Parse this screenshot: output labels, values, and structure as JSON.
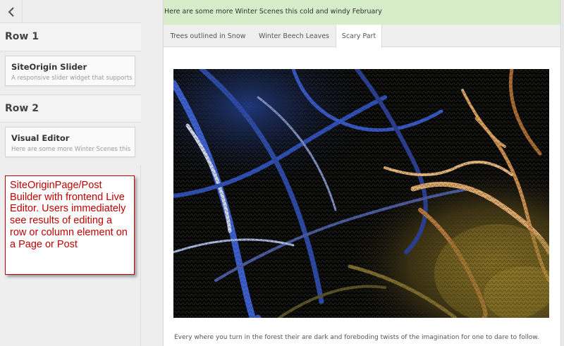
{
  "sidebar": {
    "back_icon": "chevron-left-icon",
    "rows": [
      {
        "label": "Row 1",
        "widget": {
          "title": "SiteOrigin Slider",
          "description": "A responsive slider widget that supports"
        }
      },
      {
        "label": "Row 2",
        "widget": {
          "title": "Visual Editor",
          "description": "Here are some more Winter Scenes this"
        }
      }
    ],
    "annotation": "SiteOriginPage/Post Builder with frontend Live Editor. Users immediately see results of editing a row or column element on a Page or Post"
  },
  "preview": {
    "notice": "Here are some more Winter Scenes this cold and windy February",
    "tabs": [
      {
        "label": "Trees outlined in Snow",
        "active": false
      },
      {
        "label": "Winter Beech Leaves",
        "active": false
      },
      {
        "label": "Scary Part",
        "active": true
      }
    ],
    "caption": "Every where you turn in the forest their are dark and foreboding twists of the imagination for one to dare to follow."
  },
  "colors": {
    "annotation_red": "#c00000",
    "notice_green": "#d7ecc9",
    "panel_gray": "#eeeeee"
  }
}
